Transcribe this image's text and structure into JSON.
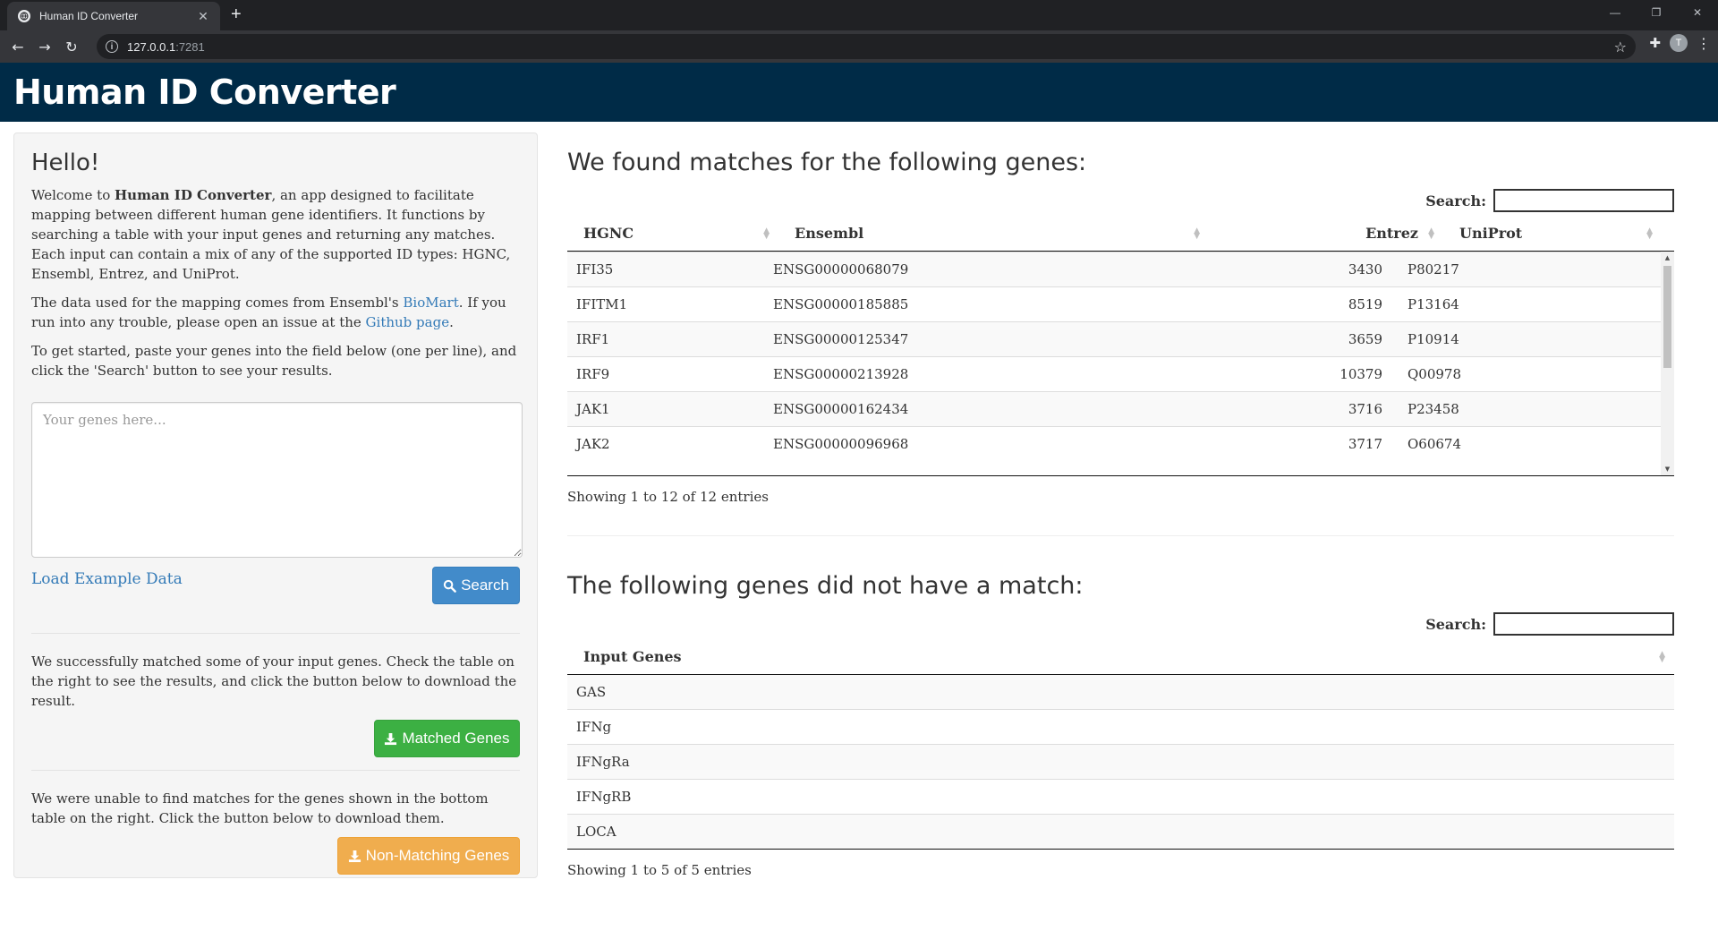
{
  "browser": {
    "tab_title": "Human ID Converter",
    "new_tab_label": "+",
    "url_host": "127.0.0.1",
    "url_port": ":7281",
    "avatar_letter": "T"
  },
  "app": {
    "title": "Human ID Converter"
  },
  "sidebar": {
    "heading": "Hello!",
    "intro": {
      "before": "Welcome to ",
      "bold": "Human ID Converter",
      "after": ", an app designed to facilitate mapping between different human gene identifiers. It functions by searching a table with your input genes and returning any matches. Each input can contain a mix of any of the supported ID types: HGNC, Ensembl, Entrez, and UniProt."
    },
    "data_source": {
      "before": "The data used for the mapping comes from Ensembl's ",
      "biomart_link": "BioMart",
      "middle": ". If you run into any trouble, please open an issue at the ",
      "github_link": "Github page",
      "after": "."
    },
    "get_started": "To get started, paste your genes into the field below (one per line), and click the 'Search' button to see your results.",
    "input_placeholder": "Your genes here...",
    "load_example": "Load Example Data",
    "search_button": "Search",
    "matched_text": "We successfully matched some of your input genes. Check the table on the right to see the results, and click the button below to download the result.",
    "matched_button": "Matched Genes",
    "unmatched_text": "We were unable to find matches for the genes shown in the bottom table on the right. Click the button below to download them.",
    "unmatched_button": "Non-Matching Genes"
  },
  "matches": {
    "heading": "We found matches for the following genes:",
    "search_label": "Search:",
    "columns": [
      "HGNC",
      "Ensembl",
      "Entrez",
      "UniProt"
    ],
    "rows": [
      [
        "IFI35",
        "ENSG00000068079",
        "3430",
        "P80217"
      ],
      [
        "IFITM1",
        "ENSG00000185885",
        "8519",
        "P13164"
      ],
      [
        "IRF1",
        "ENSG00000125347",
        "3659",
        "P10914"
      ],
      [
        "IRF9",
        "ENSG00000213928",
        "10379",
        "Q00978"
      ],
      [
        "JAK1",
        "ENSG00000162434",
        "3716",
        "P23458"
      ],
      [
        "JAK2",
        "ENSG00000096968",
        "3717",
        "O60674"
      ]
    ],
    "info": "Showing 1 to 12 of 12 entries"
  },
  "nomatch": {
    "heading": "The following genes did not have a match:",
    "search_label": "Search:",
    "column": "Input Genes",
    "rows": [
      "GAS",
      "IFNg",
      "IFNgRa",
      "IFNgRB",
      "LOCA"
    ],
    "info": "Showing 1 to 5 of 5 entries"
  },
  "colors": {
    "header_bg": "#002b47",
    "search_btn": "#428bca",
    "matched_btn": "#3cb043",
    "nonmatch_btn": "#f0ad4e",
    "link": "#337ab7"
  },
  "icons": [
    "globe-icon",
    "close-icon",
    "back-icon",
    "forward-icon",
    "reload-icon",
    "info-icon",
    "star-icon",
    "puzzle-icon",
    "menu-icon",
    "search-icon",
    "download-icon",
    "sort-icon"
  ]
}
